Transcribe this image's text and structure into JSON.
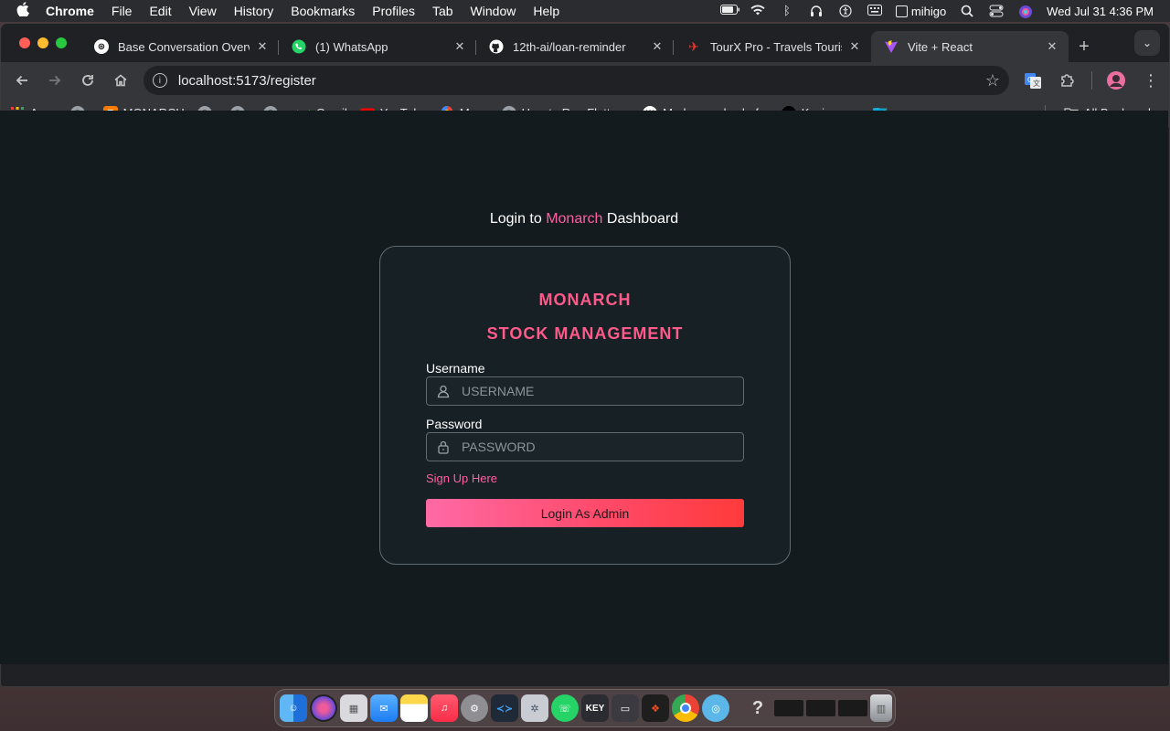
{
  "menubar": {
    "app_name": "Chrome",
    "items": [
      "File",
      "Edit",
      "View",
      "History",
      "Bookmarks",
      "Profiles",
      "Tab",
      "Window",
      "Help"
    ],
    "user": "mihigo",
    "datetime": "Wed Jul 31  4:36 PM"
  },
  "tabs": [
    {
      "title": "Base Conversation Overv",
      "favicon": "openai-icon",
      "favicon_color": "#ffffff"
    },
    {
      "title": "(1) WhatsApp",
      "favicon": "whatsapp-icon",
      "favicon_color": "#25d366"
    },
    {
      "title": "12th-ai/loan-reminder",
      "favicon": "github-icon",
      "favicon_color": "#ffffff"
    },
    {
      "title": "TourX Pro - Travels Touris",
      "favicon": "plane-icon",
      "favicon_color": "#e53935"
    },
    {
      "title": "Vite + React",
      "favicon": "vite-icon",
      "favicon_color": "#a855f7"
    }
  ],
  "toolbar": {
    "url": "localhost:5173/register"
  },
  "bookmarks": {
    "items": [
      {
        "label": "Apps",
        "icon": "apps-grid-icon"
      },
      {
        "label": "",
        "icon": "globe-icon"
      },
      {
        "label": "MONARCH",
        "icon": "monarch-icon"
      },
      {
        "label": "",
        "icon": "globe-icon"
      },
      {
        "label": "",
        "icon": "globe-icon"
      },
      {
        "label": "",
        "icon": "globe-icon"
      },
      {
        "label": "Gmail",
        "icon": "gmail-icon"
      },
      {
        "label": "YouTube",
        "icon": "youtube-icon"
      },
      {
        "label": "Maps",
        "icon": "maps-icon"
      },
      {
        "label": "How to Run Flutter...",
        "icon": "globe-icon"
      },
      {
        "label": "Modern and colorf...",
        "icon": "w-icon"
      },
      {
        "label": "Kevin_mucyo🇷🇼m...",
        "icon": "tiktok-icon"
      }
    ],
    "all_bookmarks": "All Bookmarks"
  },
  "page": {
    "heading_prefix": "Login to ",
    "heading_accent": "Monarch",
    "heading_suffix": " Dashboard",
    "brand_line1": "MONARCH",
    "brand_line2": "STOCK MANAGEMENT",
    "username_label": "Username",
    "username_placeholder": "USERNAME",
    "password_label": "Password",
    "password_placeholder": "PASSWORD",
    "signup_link": "Sign Up Here",
    "login_button": "Login As Admin",
    "accent_color": "#ff5fa2"
  },
  "dock": {
    "apps": [
      "finder-icon",
      "siri-icon",
      "launchpad-icon",
      "mail-icon",
      "notes-icon",
      "music-icon",
      "system-settings-icon",
      "vscode-icon",
      "settings-gear-icon",
      "whatsapp-icon",
      "keynote-icon",
      "window-icon",
      "figma-icon",
      "chrome-icon",
      "proxyman-icon",
      "help-icon",
      "screen-capture-icon",
      "screen-capture-icon-2",
      "screen-capture-icon-3",
      "trash-icon"
    ],
    "keynote_label": "KEY"
  }
}
